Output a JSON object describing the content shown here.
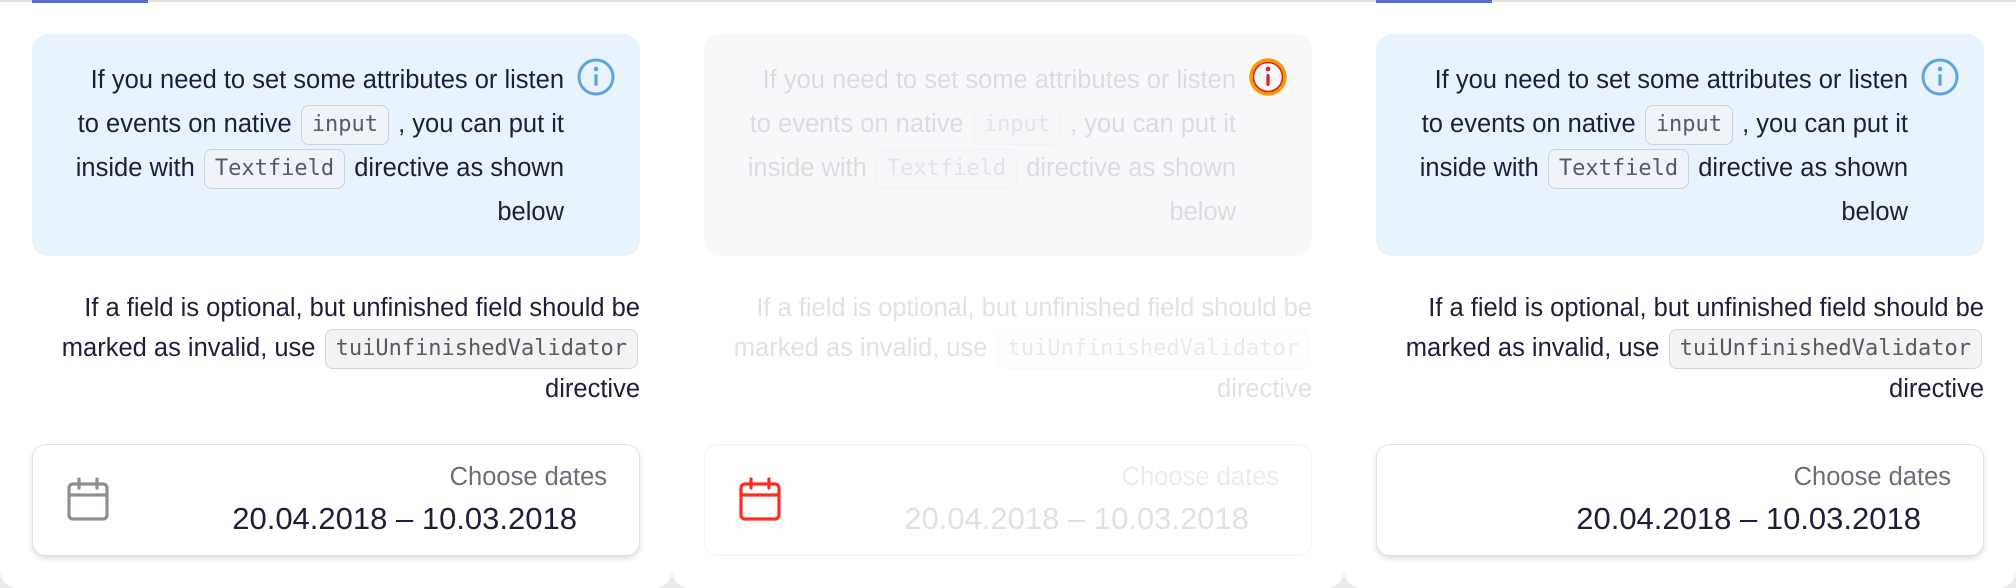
{
  "colors": {
    "info_icon": "#5ba4e6",
    "error_icon": "#e01f19",
    "error_icon_outline": "#f59a00",
    "calendar_icon": "#8c8f99",
    "calendar_icon_error": "#ff2b1f",
    "tab_accent": "#526ed3"
  },
  "panels": [
    {
      "state": "normal",
      "notice": {
        "text_before": "If you need to set some attributes or listen to events on native",
        "code1": "input",
        "text_middle": ", you can put it inside with",
        "code2": "Textfield",
        "text_after": "directive as shown below",
        "icon": "info-icon"
      },
      "body": {
        "text_before": "If a field is optional, but unfinished field should be marked as invalid, use",
        "code": "tuiUnfinishedValidator",
        "text_after": "directive"
      },
      "field": {
        "label": "Choose dates",
        "value": "20.04.2018 – 10.03.2018",
        "icon": "calendar-icon"
      }
    },
    {
      "state": "disabled",
      "notice": {
        "text_before": "If you need to set some attributes or listen to events on native",
        "code1": "input",
        "text_middle": ", you can put it inside with",
        "code2": "Textfield",
        "text_after": "directive as shown below",
        "icon": "warning-icon"
      },
      "body": {
        "text_before": "If a field is optional, but unfinished field should be marked as invalid, use",
        "code": "tuiUnfinishedValidator",
        "text_after": "directive"
      },
      "field": {
        "label": "Choose dates",
        "value": "20.04.2018 – 10.03.2018",
        "icon": "calendar-icon"
      }
    },
    {
      "state": "normal",
      "notice": {
        "text_before": "If you need to set some attributes or listen to events on native",
        "code1": "input",
        "text_middle": ", you can put it inside with",
        "code2": "Textfield",
        "text_after": "directive as shown below",
        "icon": "info-icon"
      },
      "body": {
        "text_before": "If a field is optional, but unfinished field should be marked as invalid, use",
        "code": "tuiUnfinishedValidator",
        "text_after": "directive"
      },
      "field": {
        "label": "Choose dates",
        "value": "20.04.2018 – 10.03.2018",
        "icon": "calendar-icon"
      }
    }
  ]
}
